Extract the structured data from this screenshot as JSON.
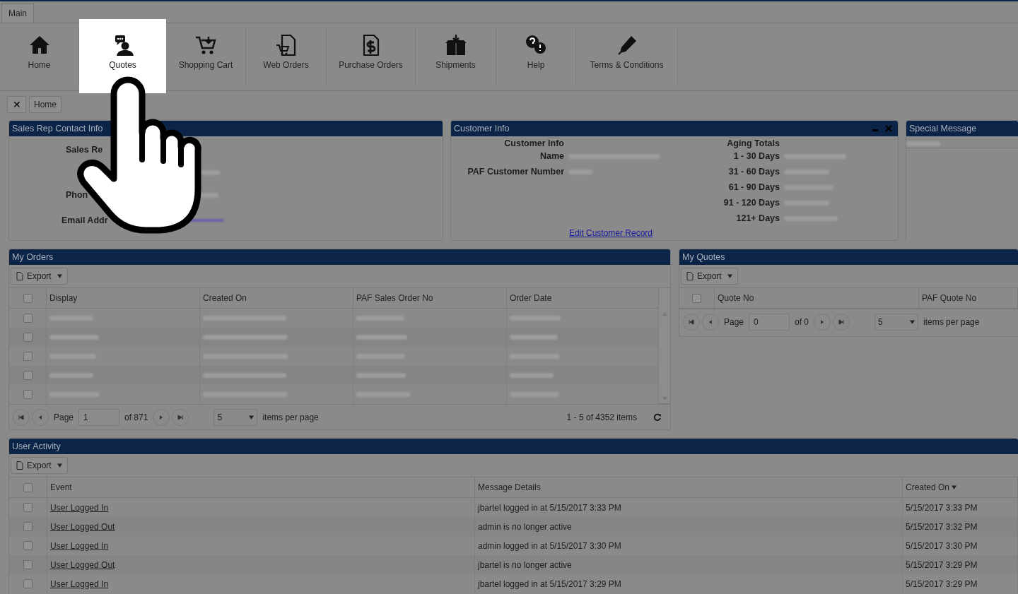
{
  "tabs": [
    {
      "label": "Main",
      "selected": true
    }
  ],
  "ribbon": [
    {
      "label": "Home",
      "kind": "home",
      "highlighted": false
    },
    {
      "label": "Quotes",
      "kind": "quotes",
      "highlighted": true
    },
    {
      "label": "Shopping Cart",
      "kind": "cart",
      "highlighted": false
    },
    {
      "label": "Web Orders",
      "kind": "weborders",
      "highlighted": false
    },
    {
      "label": "Purchase Orders",
      "kind": "purchase",
      "highlighted": false
    },
    {
      "label": "Shipments",
      "kind": "shipments",
      "highlighted": false
    },
    {
      "label": "Help",
      "kind": "help",
      "highlighted": false
    },
    {
      "label": "Terms & Conditions",
      "kind": "terms",
      "highlighted": false
    }
  ],
  "breadcrumb": {
    "close": "✕",
    "item": "Home"
  },
  "sales_rep": {
    "title": "Sales Rep Contact Info",
    "labels": [
      "Sales Re",
      "Phon",
      "Email Addr"
    ]
  },
  "customer_info": {
    "title": "Customer Info",
    "heading": "Customer Info",
    "fields": [
      "Name",
      "PAF Customer Number"
    ],
    "aging_heading": "Aging Totals",
    "aging": [
      "1 - 30 Days",
      "31 - 60 Days",
      "61 - 90 Days",
      "91 - 120 Days",
      "121+ Days"
    ],
    "link": "Edit Customer Record"
  },
  "special_message": {
    "title": "Special Message"
  },
  "orders": {
    "title": "My Orders",
    "export": "Export",
    "all_checked": false,
    "columns": [
      "Display",
      "Created On",
      "PAF Sales Order No",
      "Order Date"
    ],
    "rows": [
      {
        "checked": false
      },
      {
        "checked": false
      },
      {
        "checked": false
      },
      {
        "checked": false
      },
      {
        "checked": false
      }
    ],
    "pager": {
      "page_label": "Page",
      "page": "1",
      "of": "of 871",
      "per_page": "5",
      "per_page_label": "items per page",
      "summary": "1 - 5 of 4352 items"
    }
  },
  "quotes": {
    "title": "My Quotes",
    "export": "Export",
    "all_checked": false,
    "columns": [
      "Quote No",
      "PAF Quote No"
    ],
    "pager": {
      "page_label": "Page",
      "page": "0",
      "of": "of 0",
      "per_page": "5",
      "per_page_label": "items per page"
    }
  },
  "activity": {
    "title": "User Activity",
    "export": "Export",
    "all_checked": false,
    "columns": [
      {
        "label": "Event",
        "sorted": false
      },
      {
        "label": "Message Details",
        "sorted": false
      },
      {
        "label": "Created On",
        "sorted": true
      }
    ],
    "rows": [
      {
        "checked": false,
        "event": "User Logged In",
        "message": "jbartel logged in at 5/15/2017 3:33 PM",
        "created_on": "5/15/2017 3:33 PM"
      },
      {
        "checked": false,
        "event": "User Logged Out",
        "message": "admin is no longer active",
        "created_on": "5/15/2017 3:32 PM"
      },
      {
        "checked": false,
        "event": "User Logged In",
        "message": "admin logged in at 5/15/2017 3:30 PM",
        "created_on": "5/15/2017 3:30 PM"
      },
      {
        "checked": false,
        "event": "User Logged Out",
        "message": "jbartel is no longer active",
        "created_on": "5/15/2017 3:29 PM"
      },
      {
        "checked": false,
        "event": "User Logged In",
        "message": "jbartel logged in at 5/15/2017 3:29 PM",
        "created_on": "5/15/2017 3:29 PM"
      }
    ]
  }
}
